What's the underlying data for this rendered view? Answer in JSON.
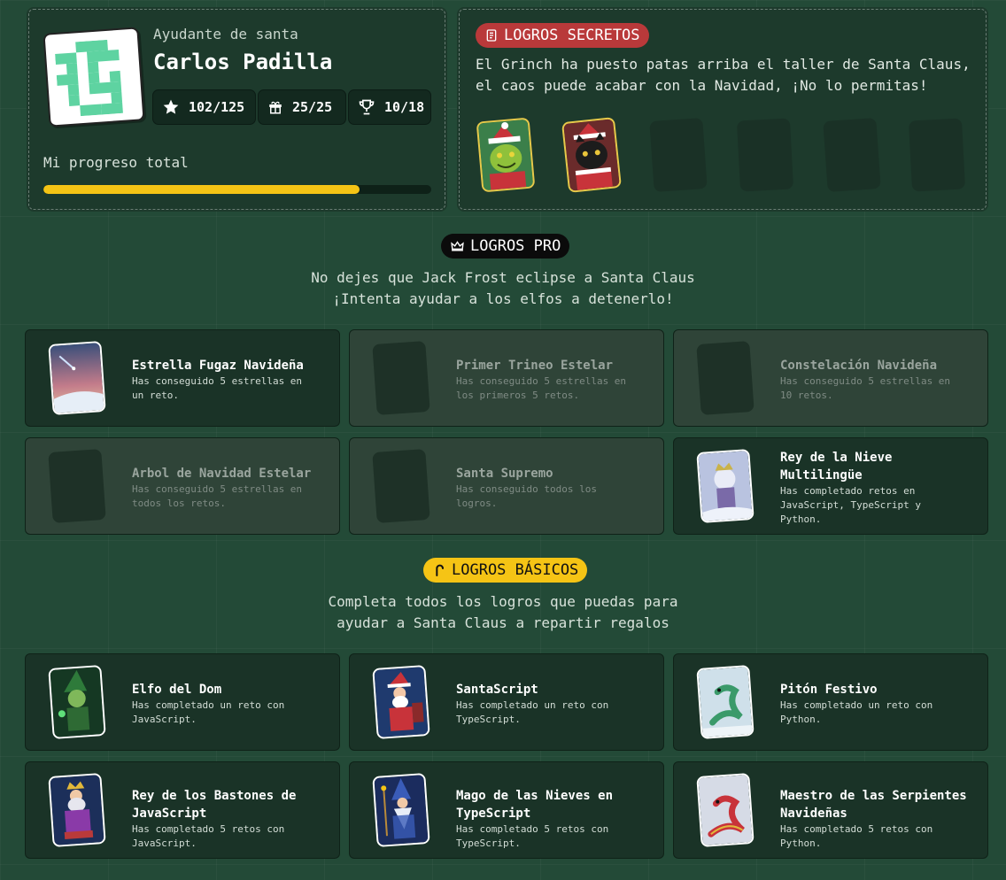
{
  "profile": {
    "role": "Ayudante de santa",
    "name": "Carlos Padilla",
    "stats": [
      {
        "icon": "star-icon",
        "value": "102/125"
      },
      {
        "icon": "gift-icon",
        "value": "25/25"
      },
      {
        "icon": "trophy-icon",
        "value": "10/18"
      }
    ],
    "progress_label": "Mi progreso total",
    "progress_fraction": 0.815
  },
  "secret": {
    "badge": "LOGROS SECRETOS",
    "description_line1": "El Grinch ha puesto patas arriba el taller de Santa Claus,",
    "description_line2": "el caos puede acabar con la Navidad, ¡No lo permitas!",
    "cards": [
      "grinch-card",
      "black-cat-card",
      "locked",
      "locked",
      "locked",
      "locked"
    ]
  },
  "pro": {
    "badge": "LOGROS PRO",
    "description_line1": "No dejes que Jack Frost eclipse a Santa Claus",
    "description_line2": "¡Intenta ayudar a los elfos a detenerlo!",
    "items": [
      {
        "title": "Estrella Fugaz Navideña",
        "desc": "Has conseguido 5 estrellas en un reto.",
        "unlocked": true
      },
      {
        "title": "Primer Trineo Estelar",
        "desc": "Has conseguido 5 estrellas en los primeros 5 retos.",
        "unlocked": false
      },
      {
        "title": "Constelación Navideña",
        "desc": "Has conseguido 5 estrellas en 10 retos.",
        "unlocked": false
      },
      {
        "title": "Arbol de Navidad Estelar",
        "desc": "Has conseguido 5 estrellas en todos los retos.",
        "unlocked": false
      },
      {
        "title": "Santa Supremo",
        "desc": "Has conseguido todos los logros.",
        "unlocked": false
      },
      {
        "title": "Rey de la Nieve Multilingüe",
        "desc": "Has completado retos en JavaScript, TypeScript y Python.",
        "unlocked": true
      }
    ]
  },
  "basic": {
    "badge": "LOGROS BÁSICOS",
    "description_line1": "Completa todos los logros que puedas para",
    "description_line2": "ayudar a Santa Claus a repartir regalos",
    "items": [
      {
        "title": "Elfo del Dom",
        "desc": "Has completado un reto con JavaScript."
      },
      {
        "title": "SantaScript",
        "desc": "Has completado un reto con TypeScript."
      },
      {
        "title": "Pitón Festivo",
        "desc": "Has completado un reto con Python."
      },
      {
        "title": "Rey de los Bastones de JavaScript",
        "desc": "Has completado 5 retos con JavaScript."
      },
      {
        "title": "Mago de las Nieves en TypeScript",
        "desc": "Has completado 5 retos con TypeScript."
      },
      {
        "title": "Maestro de las Serpientes Navideñas",
        "desc": "Has completado 5 retos con Python."
      }
    ]
  },
  "colors": {
    "background": "#234a37",
    "panel": "#1d3a2c",
    "progress": "#f5c415",
    "secret_badge": "#b9393a",
    "pro_badge": "#0b0b0b",
    "basic_badge": "#f5c415"
  }
}
